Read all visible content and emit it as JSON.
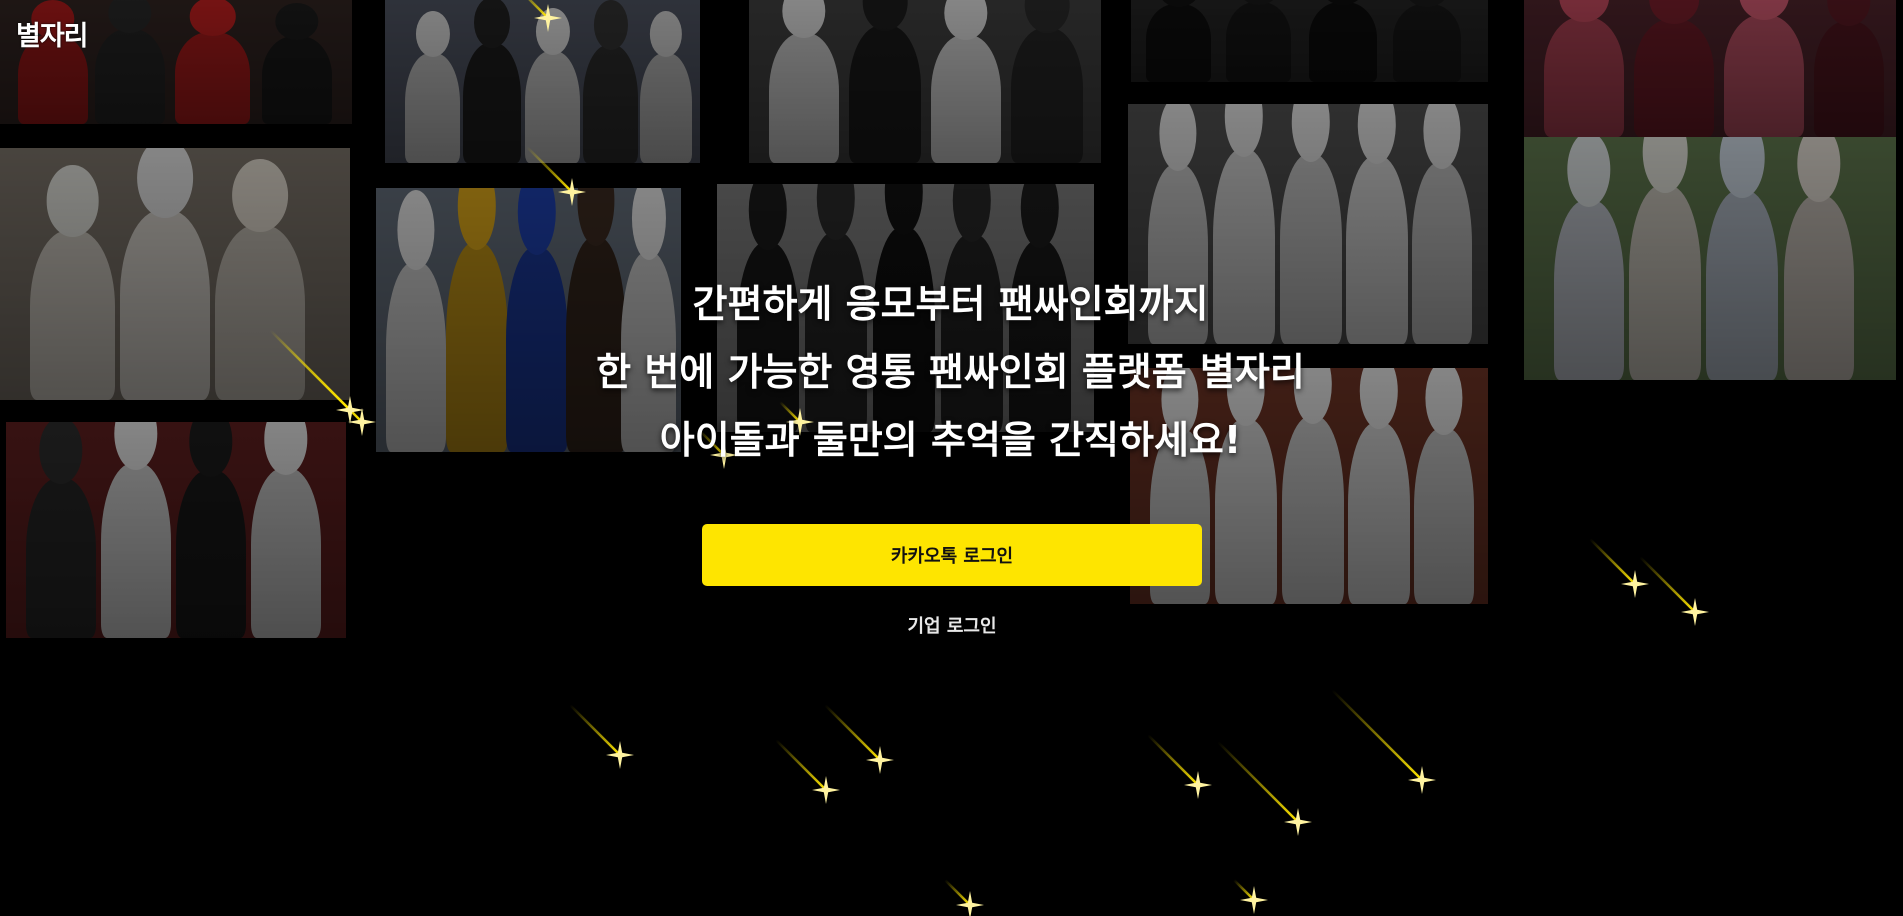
{
  "app": {
    "logo_text": "별자리"
  },
  "hero": {
    "headline_line1": "간편하게 응모부터 팬싸인회까지",
    "headline_line2": "한 번에 가능한 영통 팬싸인회 플랫폼 별자리",
    "headline_line3": "아이돌과 둘만의 추억을 간직하세요!"
  },
  "auth": {
    "kakao_login_label": "카카오톡 로그인",
    "corporate_login_label": "기업 로그인"
  },
  "colors": {
    "background": "#000000",
    "kakao_yellow": "#FEE500",
    "star_yellow": "#FFE600",
    "text_white": "#FFFFFF"
  },
  "decorations": {
    "background": "idol-group-photo-collage",
    "overlay": "shooting-star-icons"
  }
}
